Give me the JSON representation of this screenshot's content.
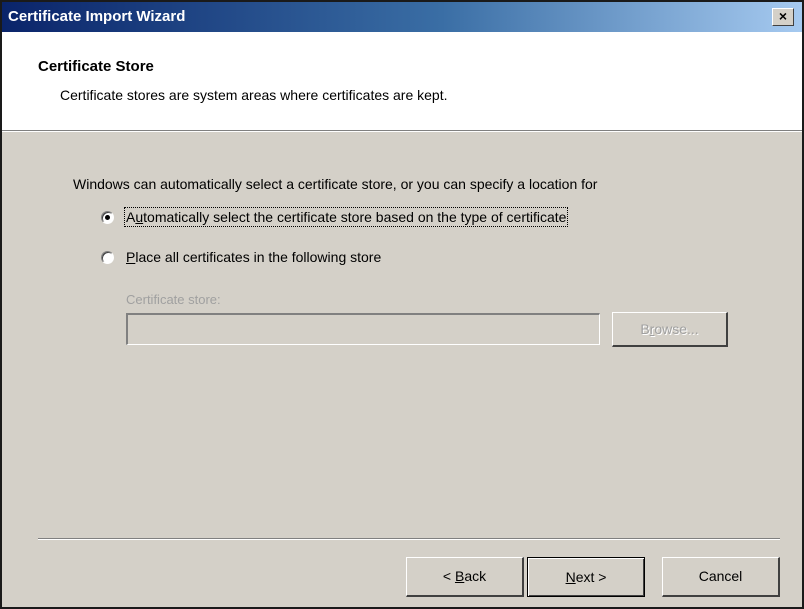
{
  "window": {
    "title": "Certificate Import Wizard",
    "close_symbol": "×"
  },
  "header": {
    "title": "Certificate Store",
    "subtitle": "Certificate stores are system areas where certificates are kept."
  },
  "body": {
    "intro": "Windows can automatically select a certificate store, or you can specify a location for",
    "options": [
      {
        "prefix": "A",
        "mnemonic": "u",
        "rest": "tomatically select the certificate store based on the type of certificate",
        "checked": true
      },
      {
        "prefix": "",
        "mnemonic": "P",
        "rest": "lace all certificates in the following store",
        "checked": false
      }
    ],
    "store_label": "Certificate store:",
    "store_value": "",
    "browse": {
      "mnemonic": "r",
      "pre": "B",
      "post": "owse..."
    }
  },
  "buttons": {
    "back": {
      "pre": "< ",
      "mnemonic": "B",
      "post": "ack"
    },
    "next": {
      "pre": "",
      "mnemonic": "N",
      "post": "ext >"
    },
    "cancel": "Cancel"
  },
  "colors": {
    "titlebar_start": "#0a246a",
    "titlebar_end": "#a6caf0",
    "face": "#d4d0c8",
    "disabled_text": "#a0a0a0"
  }
}
